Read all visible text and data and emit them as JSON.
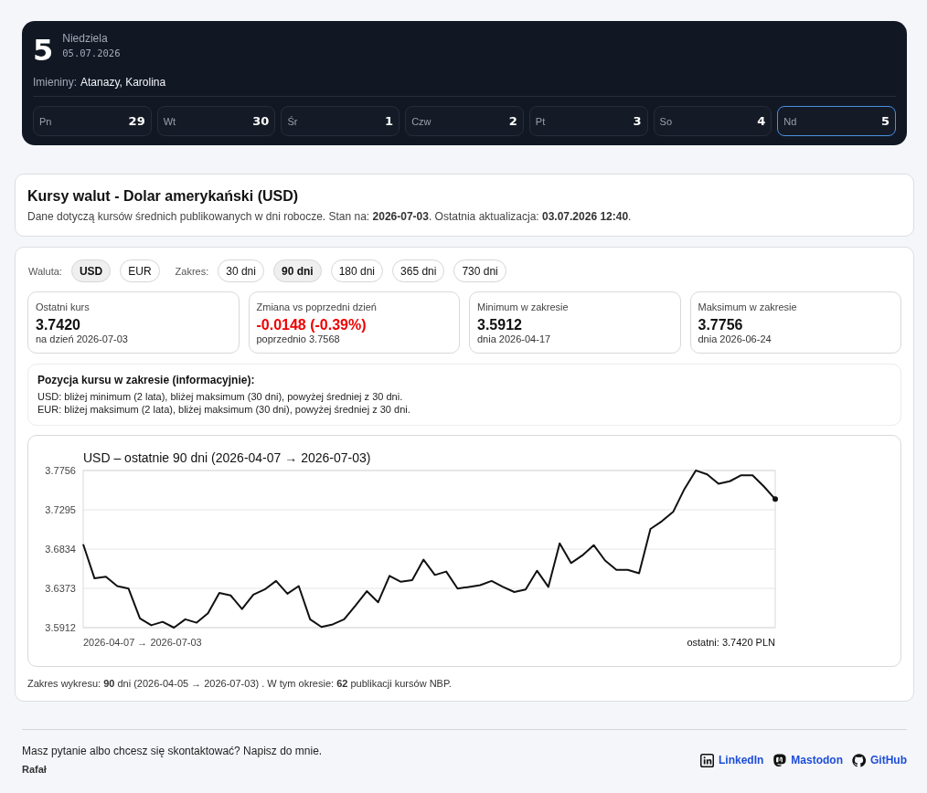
{
  "day_header": {
    "day_number": "5",
    "weekday": "Niedziela",
    "date": "05.07.2026",
    "nameday_label": "Imieniny:",
    "nameday_names": "Atanazy, Karolina"
  },
  "week_days": [
    {
      "label": "Pn",
      "number": "29",
      "selected": false
    },
    {
      "label": "Wt",
      "number": "30",
      "selected": false
    },
    {
      "label": "Śr",
      "number": "1",
      "selected": false
    },
    {
      "label": "Czw",
      "number": "2",
      "selected": false
    },
    {
      "label": "Pt",
      "number": "3",
      "selected": false
    },
    {
      "label": "So",
      "number": "4",
      "selected": false
    },
    {
      "label": "Nd",
      "number": "5",
      "selected": true
    }
  ],
  "page_header": {
    "title": "Kursy walut - Dolar amerykański (USD)",
    "description": "Dane dotyczą kursów średnich publikowanych w dni robocze. Stan na: **2026-07-03**. Ostatnia aktualizacja: **03.07.2026 12:40**."
  },
  "filters": {
    "currency_label": "Waluta:",
    "currencies": [
      {
        "label": "USD",
        "selected": true
      },
      {
        "label": "EUR",
        "selected": false
      }
    ],
    "range_label": "Zakres:",
    "ranges": [
      {
        "label": "30 dni",
        "selected": false
      },
      {
        "label": "90 dni",
        "selected": true
      },
      {
        "label": "180 dni",
        "selected": false
      },
      {
        "label": "365 dni",
        "selected": false
      },
      {
        "label": "730 dni",
        "selected": false
      }
    ]
  },
  "stats": [
    {
      "label": "Ostatni kurs",
      "value": "3.7420",
      "note": "na dzień 2026-07-03",
      "color": "#111111"
    },
    {
      "label": "Zmiana vs poprzedni dzień",
      "value": "-0.0148 (-0.39%)",
      "note": "poprzednio 3.7568",
      "color": "#ee0000"
    },
    {
      "label": "Minimum w zakresie",
      "value": "3.5912",
      "note": "dnia 2026-04-17",
      "color": "#111111"
    },
    {
      "label": "Maksimum w zakresie",
      "value": "3.7756",
      "note": "dnia 2026-06-24",
      "color": "#111111"
    }
  ],
  "position_info": {
    "title": "Pozycja kursu w zakresie (informacyjnie):",
    "lines": [
      "USD: bliżej minimum (2 lata), bliżej maksimum (30 dni), powyżej średniej z 30 dni.",
      "EUR: bliżej maksimum (2 lata), bliżej maksimum (30 dni), powyżej średniej z 30 dni."
    ]
  },
  "chart": {
    "chart_data": {
      "type": "line",
      "title": "USD – ostatnie 90 dni (2026-04-07 → 2026-07-03)",
      "xlabel": "2026-04-07 → 2026-07-03",
      "ylim": [
        3.5912,
        3.7756
      ],
      "yticks": [
        3.5912,
        3.6373,
        3.6834,
        3.7295,
        3.7756
      ],
      "grid": true,
      "series": [
        {
          "color": "#111111",
          "values": [
            3.689,
            3.649,
            3.651,
            3.64,
            3.637,
            3.602,
            3.594,
            3.598,
            3.5912,
            3.601,
            3.597,
            3.608,
            3.632,
            3.629,
            3.613,
            3.63,
            3.636,
            3.646,
            3.631,
            3.64,
            3.601,
            3.592,
            3.595,
            3.601,
            3.617,
            3.634,
            3.621,
            3.652,
            3.645,
            3.647,
            3.671,
            3.653,
            3.657,
            3.637,
            3.639,
            3.641,
            3.646,
            3.639,
            3.633,
            3.636,
            3.658,
            3.639,
            3.69,
            3.667,
            3.676,
            3.688,
            3.67,
            3.659,
            3.659,
            3.655,
            3.707,
            3.716,
            3.727,
            3.754,
            3.7756,
            3.771,
            3.76,
            3.763,
            3.77,
            3.77,
            3.7568,
            3.742
          ]
        }
      ]
    },
    "last_reading": "ostatni: 3.7420 PLN"
  },
  "chart_footnote": "Zakres wykresu: **90** dni (2026-04-05 → 2026-07-03) . W tym okresie: **62** publikacji kursów NBP.",
  "footer": {
    "message": "Masz pytanie albo chcesz się skontaktować? Napisz do mnie.",
    "author": "Rafał",
    "links": [
      {
        "kind": "linkedin",
        "label": "LinkedIn"
      },
      {
        "kind": "mastodon",
        "label": "Mastodon"
      },
      {
        "kind": "github",
        "label": "GitHub"
      }
    ]
  }
}
